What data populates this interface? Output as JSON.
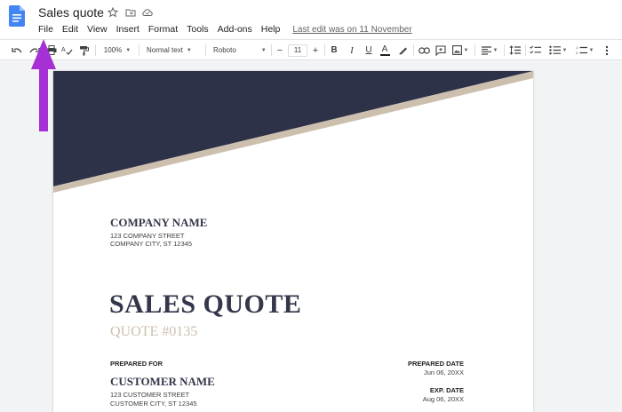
{
  "header": {
    "title": "Sales quote",
    "menu": [
      "File",
      "Edit",
      "View",
      "Insert",
      "Format",
      "Tools",
      "Add-ons",
      "Help"
    ],
    "last_edit": "Last edit was on 11 November"
  },
  "toolbar": {
    "zoom": "100%",
    "style": "Normal text",
    "font": "Roboto",
    "font_size": "11",
    "minus": "−",
    "plus": "+",
    "bold": "B",
    "italic": "I",
    "underline": "U",
    "text_color": "A"
  },
  "colors": {
    "banner_navy": "#2e3248",
    "banner_stripe": "#cdbfae",
    "annotation_arrow": "#a62fd6",
    "docs_blue": "#4285f4"
  },
  "document": {
    "company_name": "COMPANY NAME",
    "company_street": "123 COMPANY STREET",
    "company_city": "COMPANY CITY, ST 12345",
    "heading": "SALES QUOTE",
    "quote_number": "QUOTE #0135",
    "prepared_for_label": "PREPARED FOR",
    "customer_name": "CUSTOMER NAME",
    "customer_street": "123 CUSTOMER STREET",
    "customer_city": "CUSTOMER CITY, ST 12345",
    "prepared_date_label": "PREPARED DATE",
    "prepared_date": "Jun 06, 20XX",
    "exp_date_label": "EXP. DATE",
    "exp_date": "Aug 06, 20XX"
  }
}
